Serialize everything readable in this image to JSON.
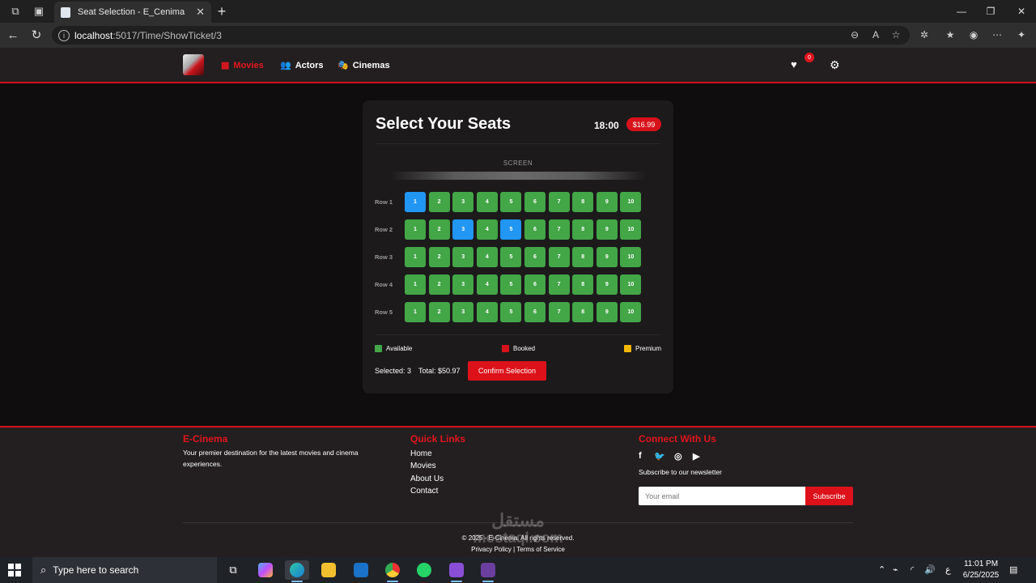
{
  "browser": {
    "tab_title": "Seat Selection - E_Cenima",
    "url_host": "localhost",
    "url_path": ":5017/Time/ShowTicket/3",
    "new_tab_label": "+",
    "close_tab_label": "✕"
  },
  "header": {
    "nav": [
      {
        "label": "Movies",
        "icon": "film-icon",
        "active": true
      },
      {
        "label": "Actors",
        "icon": "users-icon",
        "active": false
      },
      {
        "label": "Cinemas",
        "icon": "cinema-icon",
        "active": false
      }
    ],
    "favorites_count": "0"
  },
  "seat_card": {
    "title": "Select Your Seats",
    "time": "18:00",
    "price": "$16.99",
    "screen_label": "SCREEN",
    "rows": [
      {
        "label": "Row 1",
        "seats": [
          "1",
          "2",
          "3",
          "4",
          "5",
          "6",
          "7",
          "8",
          "9",
          "10"
        ],
        "selected": [
          1
        ]
      },
      {
        "label": "Row 2",
        "seats": [
          "1",
          "2",
          "3",
          "4",
          "5",
          "6",
          "7",
          "8",
          "9",
          "10"
        ],
        "selected": [
          3,
          5
        ]
      },
      {
        "label": "Row 3",
        "seats": [
          "1",
          "2",
          "3",
          "4",
          "5",
          "6",
          "7",
          "8",
          "9",
          "10"
        ],
        "selected": []
      },
      {
        "label": "Row 4",
        "seats": [
          "1",
          "2",
          "3",
          "4",
          "5",
          "6",
          "7",
          "8",
          "9",
          "10"
        ],
        "selected": []
      },
      {
        "label": "Row 5",
        "seats": [
          "1",
          "2",
          "3",
          "4",
          "5",
          "6",
          "7",
          "8",
          "9",
          "10"
        ],
        "selected": []
      }
    ],
    "legend": [
      {
        "label": "Available",
        "color": "#43a647"
      },
      {
        "label": "Booked",
        "color": "#d8121b"
      },
      {
        "label": "Premium",
        "color": "#f5b800"
      }
    ],
    "selected_text": "Selected: 3",
    "total_text": "Total: $50.97",
    "confirm_label": "Confirm Selection",
    "colors": {
      "available": "#43a647",
      "selected": "#2196f3",
      "accent": "#d8121b"
    }
  },
  "footer": {
    "brand_title": "E-Cinema",
    "brand_text": "Your premier destination for the latest movies and cinema experiences.",
    "links_title": "Quick Links",
    "links": [
      "Home",
      "Movies",
      "About Us",
      "Contact"
    ],
    "connect_title": "Connect With Us",
    "social": [
      "facebook-icon",
      "twitter-icon",
      "instagram-icon",
      "youtube-icon"
    ],
    "newsletter_text": "Subscribe to our newsletter",
    "email_placeholder": "Your email",
    "subscribe_label": "Subscribe",
    "copyright": "© 2025 - E-Cinema. All rights reserved.",
    "legal": "Privacy Policy | Terms of Service"
  },
  "watermark": {
    "arabic": "مستقل",
    "latin": "mostaql.com"
  },
  "taskbar": {
    "search_placeholder": "Type here to search",
    "time": "11:01 PM",
    "date": "6/25/2025",
    "lang": "ع"
  }
}
